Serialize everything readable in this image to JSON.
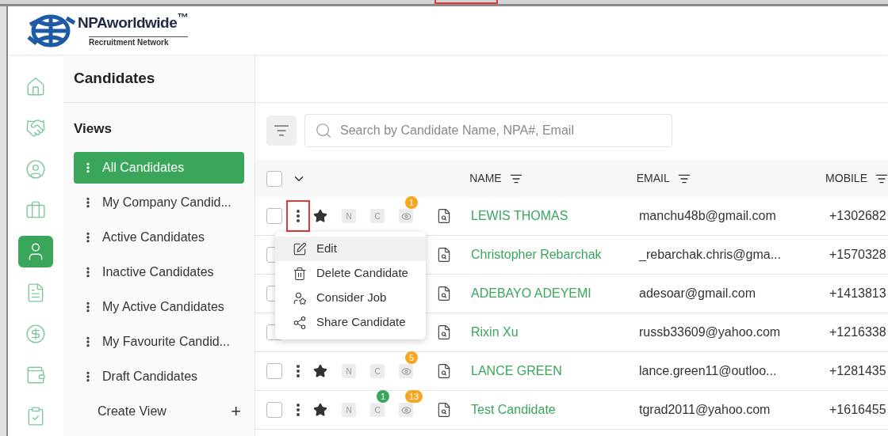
{
  "logo": {
    "name": "NPAworldwide$^{™}$",
    "tagline": "Recruitment Network"
  },
  "rail": [
    {
      "kind": "home",
      "selected": false
    },
    {
      "kind": "deal",
      "selected": false
    },
    {
      "kind": "contact",
      "selected": false
    },
    {
      "kind": "job",
      "selected": false
    },
    {
      "kind": "candidate",
      "selected": true
    },
    {
      "kind": "document",
      "selected": false
    },
    {
      "kind": "payment",
      "selected": false
    },
    {
      "kind": "alert",
      "selected": false
    },
    {
      "kind": "task",
      "selected": false
    }
  ],
  "panel": {
    "title": "Candidates",
    "views_heading": "Views",
    "views": [
      {
        "label": "All Candidates",
        "selected": true
      },
      {
        "label": "My Company Candid...",
        "selected": false
      },
      {
        "label": "Active Candidates",
        "selected": false
      },
      {
        "label": "Inactive Candidates",
        "selected": false
      },
      {
        "label": "My Active Candidates",
        "selected": false
      },
      {
        "label": "My Favourite Candid...",
        "selected": false
      },
      {
        "label": "Draft Candidates",
        "selected": false
      }
    ],
    "create_view": "Create View",
    "create_icon": "+"
  },
  "search": {
    "placeholder": "Search by Candidate Name, NPA#, Email"
  },
  "table": {
    "header_checked": false,
    "columns": [
      "NAME",
      "EMAIL",
      "MOBILE"
    ],
    "rows": [
      {
        "checked": false,
        "actions": {
          "highlighted": true,
          "favourite": true,
          "tags": [
            "N",
            "C"
          ],
          "eye_count": "1"
        },
        "name": "LEWIS THOMAS",
        "email": "manchu48b@gmail.com",
        "mobile": "+1302682"
      },
      {
        "checked": false,
        "name": "Christopher Rebarchak",
        "email": "_rebarchak.chris@gma...",
        "mobile": "+1570328"
      },
      {
        "checked": false,
        "name": "ADEBAYO ADEYEMI",
        "email": "adesoar@gmail.com",
        "mobile": "+1413813"
      },
      {
        "checked": false,
        "name": "Rixin Xu",
        "email": "russb33609@yahoo.com",
        "mobile": "+1216338"
      },
      {
        "checked": false,
        "actions": {
          "highlighted": false,
          "favourite": true,
          "tags": [
            "N",
            "C"
          ],
          "eye_count": "5"
        },
        "name": "LANCE GREEN",
        "email": "lance.green11@outloo...",
        "mobile": "+1281435"
      },
      {
        "checked": false,
        "actions": {
          "highlighted": false,
          "favourite": true,
          "tags": [
            "N",
            "C"
          ],
          "c_count": "1",
          "eye_count": "13"
        },
        "name": "Test Candidate",
        "email": "tgrad2011@yahoo.com",
        "mobile": "+1616455"
      }
    ]
  },
  "menu": [
    {
      "kind": "edit",
      "label": "Edit",
      "selected": true
    },
    {
      "kind": "delete",
      "label": "Delete Candidate",
      "selected": false
    },
    {
      "kind": "consider",
      "label": "Consider Job",
      "selected": false
    },
    {
      "kind": "share",
      "label": "Share Candidate",
      "selected": false
    }
  ]
}
